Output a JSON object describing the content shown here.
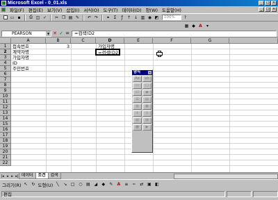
{
  "window": {
    "title": "Microsoft Excel - 0_01.xls"
  },
  "menu": {
    "items": [
      "파일(F)",
      "편집(E)",
      "보기(V)",
      "삽입(I)",
      "서식(O)",
      "도구(T)",
      "데이터(D)",
      "창(W)",
      "도움말(H)"
    ]
  },
  "toolbar": {
    "zoom": "100%"
  },
  "formula_bar": {
    "name_box": "PEARSON",
    "formula": "=검색!D2"
  },
  "sheet": {
    "columns": [
      "A",
      "B",
      "C",
      "D",
      "E",
      "F",
      "G"
    ],
    "rows": [
      "1",
      "2",
      "3",
      "4",
      "5",
      "6",
      "7",
      "8",
      "9",
      "10",
      "11",
      "12",
      "13",
      "14",
      "15",
      "16",
      "17",
      "18",
      "19",
      "20",
      "21",
      "22"
    ],
    "cells": {
      "A1": "접속번호",
      "B1": "3",
      "D1": "가입자명",
      "A2": "계약자명",
      "D2": "=검색!D2",
      "A3": "가입자명",
      "A4": "ID",
      "A5": "주민번호"
    }
  },
  "palette": {
    "title": "양식"
  },
  "tabs": [
    "데이터",
    "조건",
    "검색"
  ],
  "drawbar": {
    "draw_label": "그리기(R)",
    "autoshape_label": "도형(U)"
  },
  "status": {
    "text": "편집"
  }
}
